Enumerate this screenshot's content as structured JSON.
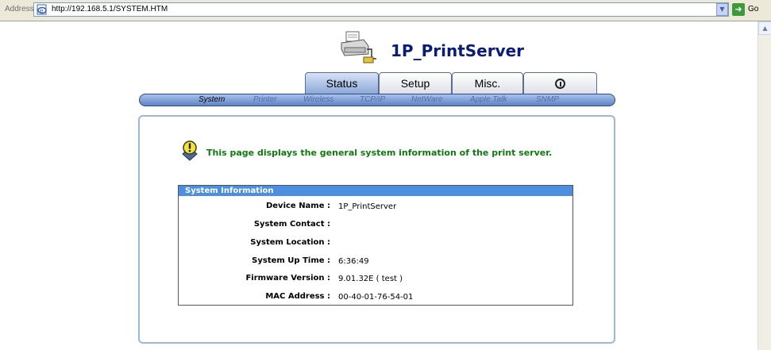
{
  "addressbar": {
    "label": "Address",
    "url": "http://192.168.5.1/SYSTEM.HTM",
    "go_label": "Go"
  },
  "header": {
    "title": "1P_PrintServer"
  },
  "tabs": [
    {
      "label": "Status",
      "active": true
    },
    {
      "label": "Setup",
      "active": false
    },
    {
      "label": "Misc.",
      "active": false
    },
    {
      "label": "",
      "icon": "info-icon",
      "active": false
    }
  ],
  "subnav": [
    {
      "label": "System",
      "active": true
    },
    {
      "label": "Printer",
      "active": false
    },
    {
      "label": "Wireless",
      "active": false
    },
    {
      "label": "TCP/IP",
      "active": false
    },
    {
      "label": "NetWare",
      "active": false
    },
    {
      "label": "Apple Talk",
      "active": false
    },
    {
      "label": "SNMP",
      "active": false
    }
  ],
  "intro": {
    "icon": "warning-icon",
    "text": "This page displays the general system information of the print server."
  },
  "system_info": {
    "heading": "System Information",
    "rows": [
      {
        "label": "Device Name :",
        "value": "1P_PrintServer"
      },
      {
        "label": "System Contact :",
        "value": ""
      },
      {
        "label": "System Location :",
        "value": ""
      },
      {
        "label": "System Up Time :",
        "value": "6:36:49"
      },
      {
        "label": "Firmware Version :",
        "value": "9.01.32E ( test )"
      },
      {
        "label": "MAC Address :",
        "value": "00-40-01-76-54-01"
      }
    ]
  },
  "colors": {
    "title": "#0a1c7a",
    "intro_text": "#0f7a0f",
    "info_header": "#4c8fe0",
    "panel_border": "#9cb7de"
  }
}
